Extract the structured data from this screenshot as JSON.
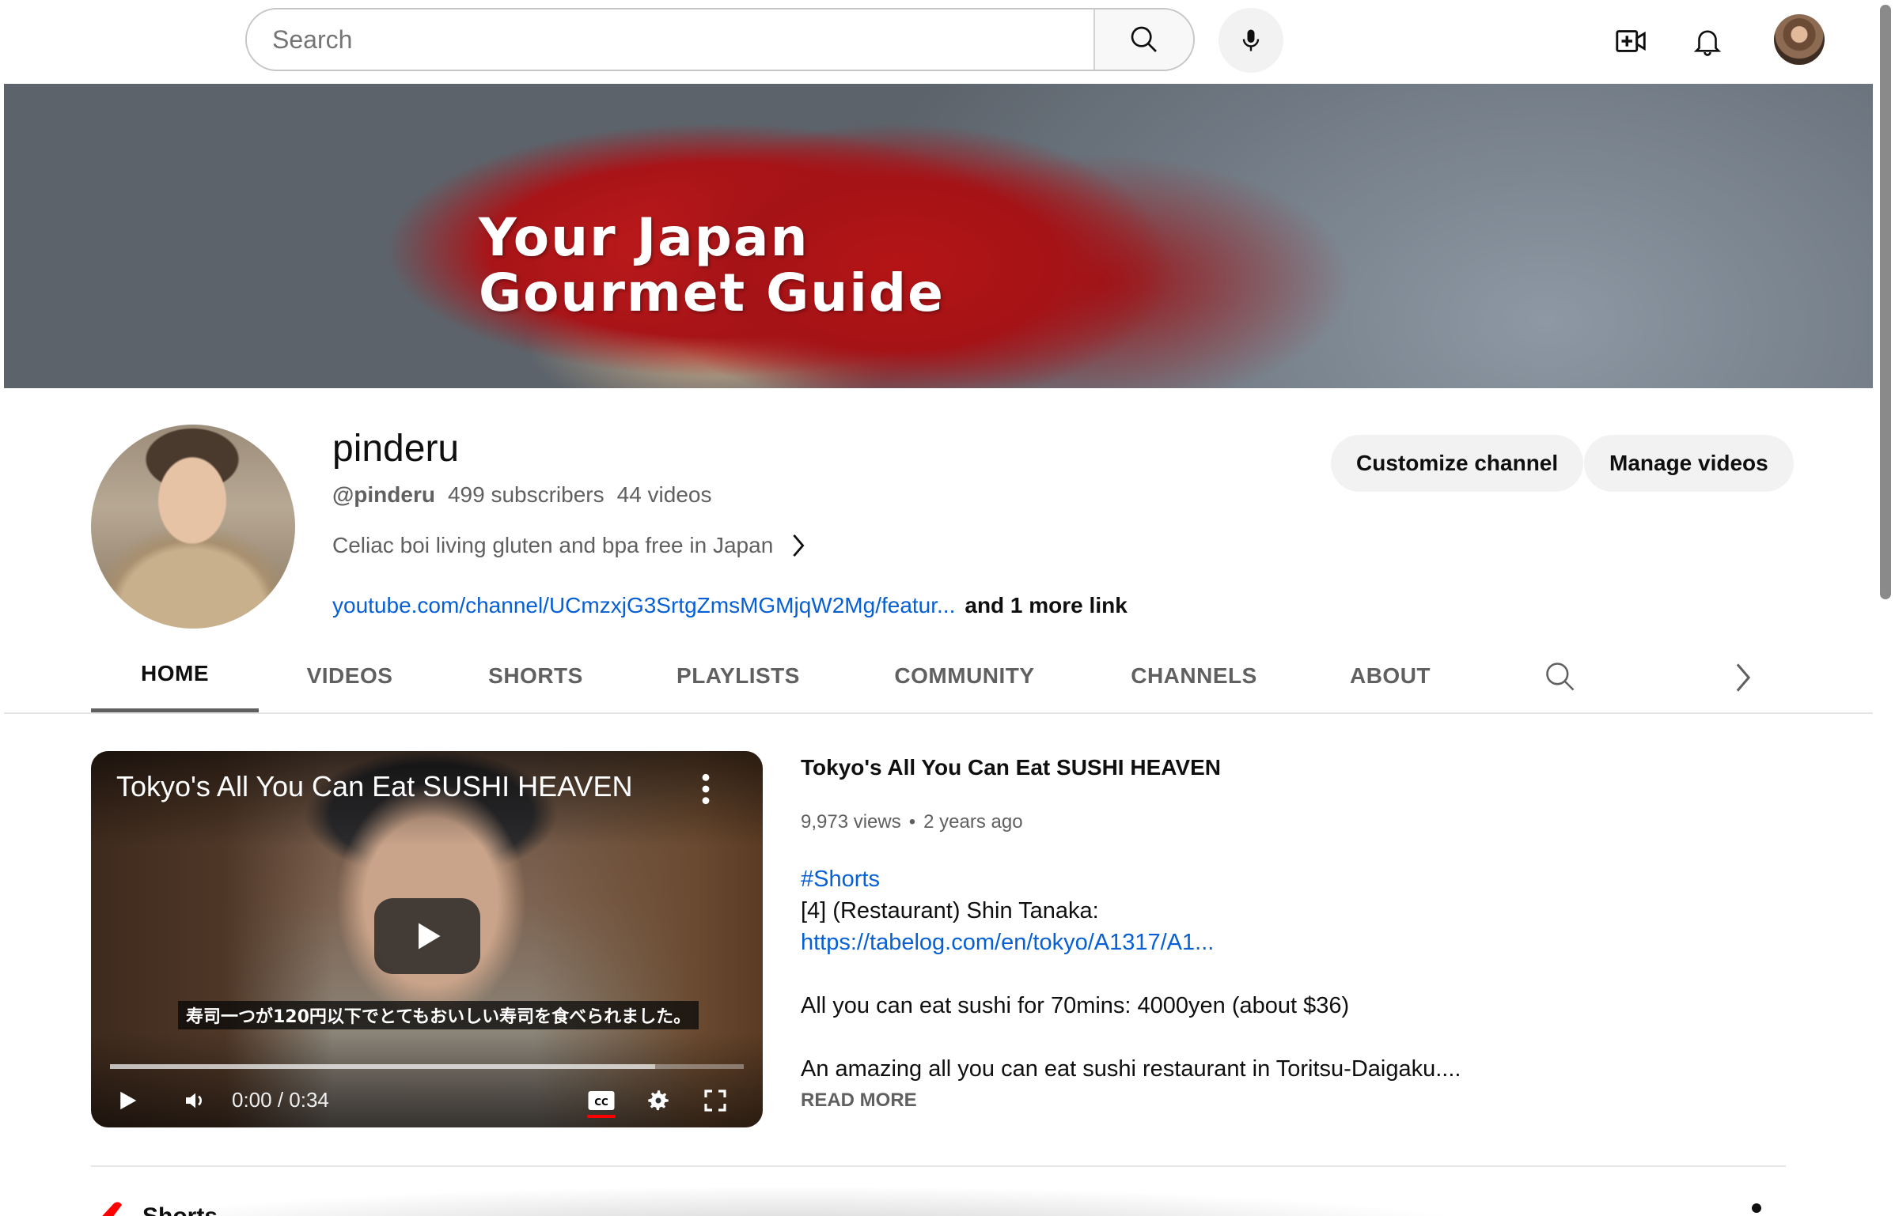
{
  "topbar": {
    "search_placeholder": "Search",
    "icons": [
      "search-icon",
      "mic-icon",
      "create-video-icon",
      "notifications-bell-icon",
      "account-avatar"
    ]
  },
  "banner": {
    "title_line1": "Your Japan",
    "title_line2": "Gourmet Guide"
  },
  "channel": {
    "name": "pinderu",
    "handle": "@pinderu",
    "subscribers": "499 subscribers",
    "videos": "44 videos",
    "description": "Celiac boi living gluten and bpa free in Japan",
    "link": "youtube.com/channel/UCmzxjG3SrtgZmsMGMjqW2Mg/featur...",
    "more_links": "and 1 more link",
    "customize_label": "Customize channel",
    "manage_label": "Manage videos"
  },
  "tabs": [
    {
      "label": "HOME",
      "active": true
    },
    {
      "label": "VIDEOS",
      "active": false
    },
    {
      "label": "SHORTS",
      "active": false
    },
    {
      "label": "PLAYLISTS",
      "active": false
    },
    {
      "label": "COMMUNITY",
      "active": false
    },
    {
      "label": "CHANNELS",
      "active": false
    },
    {
      "label": "ABOUT",
      "active": false
    }
  ],
  "player": {
    "title": "Tokyo's All You Can Eat SUSHI HEAVEN",
    "subtitle": "寿司一つが120円以下でとてもおいしい寿司を食べられました。",
    "time": "0:00 / 0:34",
    "progress": 0.86,
    "captions_on": true
  },
  "featured": {
    "title": "Tokyo's All You Can Eat SUSHI HEAVEN",
    "views": "9,973 views",
    "separator": "•",
    "age": "2 years ago",
    "hashtag": "#Shorts",
    "line1": "[4] (Restaurant) Shin Tanaka:",
    "url": "https://tabelog.com/en/tokyo/A1317/A1...",
    "line2": "All you can eat sushi for 70mins: 4000yen (about $36)",
    "line3": "An amazing all you can eat sushi restaurant in Toritsu-Daigaku....",
    "read_more": "READ MORE"
  },
  "shorts_section": {
    "label": "Shorts"
  },
  "colors": {
    "link": "#065fd4",
    "secondary_text": "#606060",
    "brand_red": "#ff0000"
  }
}
